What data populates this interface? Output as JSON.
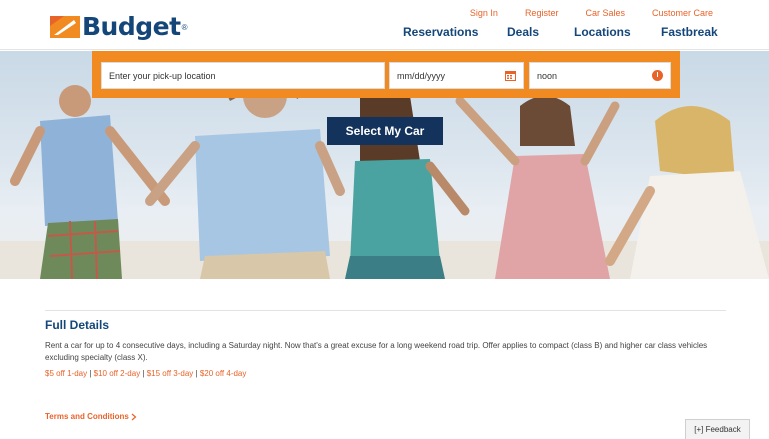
{
  "brand": {
    "name": "Budget",
    "reg_mark": "®",
    "accent_color": "#e8632a",
    "navy_color": "#14467a",
    "search_bar_color": "#f18a21"
  },
  "utility_nav": [
    "Sign In",
    "Register",
    "Car Sales",
    "Customer Care"
  ],
  "main_nav": [
    "Reservations",
    "Deals",
    "Locations",
    "Fastbreak"
  ],
  "search": {
    "location_placeholder": "Enter your pick-up location",
    "date_placeholder": "mm/dd/yyyy",
    "date_icon": "calendar-icon",
    "time_value": "noon",
    "time_icon": "clock-icon",
    "submit_label": "Select My Car"
  },
  "details": {
    "title": "Full Details",
    "body": "Rent a car for up to 4 consecutive days, including a Saturday night.  Now that's a great excuse for a long weekend road trip. Offer applies to compact (class B) and higher car class vehicles excluding specialty (class X).",
    "offers": [
      "$5 off 1-day",
      "$10 off 2-day",
      "$15 off 3-day",
      "$20 off 4-day"
    ],
    "offer_separator": " | ",
    "terms_label": "Terms and Conditions",
    "terms_icon": "chevron-right-icon"
  },
  "feedback": {
    "label": "[+] Feedback"
  }
}
